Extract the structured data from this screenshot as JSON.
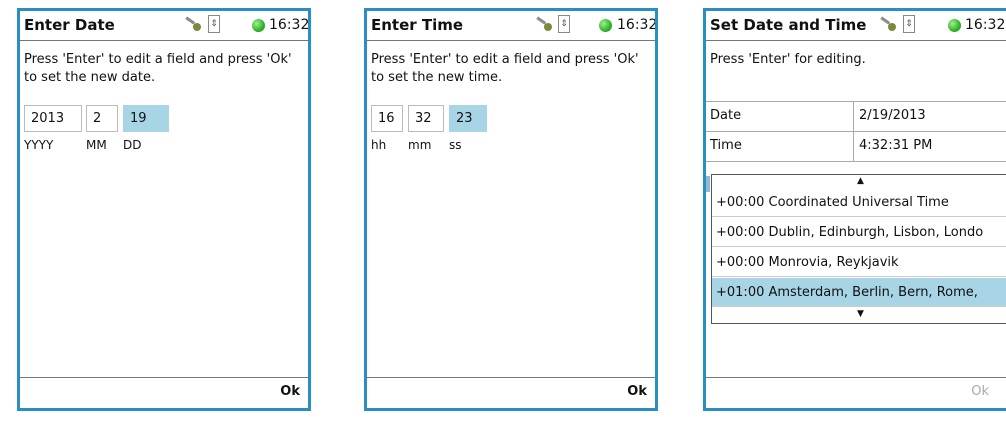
{
  "screens": [
    {
      "title": "Enter Date",
      "clock": "16:32",
      "instruction": "Press 'Enter' to edit a field and press 'Ok' to set the new date.",
      "fields": [
        {
          "value": "2013",
          "label": "YYYY"
        },
        {
          "value": "2",
          "label": "MM"
        },
        {
          "value": "19",
          "label": "DD",
          "active": true
        }
      ],
      "ok_label": "Ok"
    },
    {
      "title": "Enter Time",
      "clock": "16:32",
      "instruction": "Press 'Enter' to edit a field and press 'Ok' to set the new time.",
      "fields": [
        {
          "value": "16",
          "label": "hh"
        },
        {
          "value": "32",
          "label": "mm"
        },
        {
          "value": "23",
          "label": "ss",
          "active": true
        }
      ],
      "ok_label": "Ok"
    },
    {
      "title": "Set Date and Time",
      "clock": "16:32",
      "instruction": "Press 'Enter' for editing.",
      "rows": [
        {
          "key": "Date",
          "value": "2/19/2013"
        },
        {
          "key": "Time",
          "value": "4:32:31 PM"
        }
      ],
      "timezones": [
        "+00:00 Coordinated Universal Time",
        "+00:00 Dublin, Edinburgh, Lisbon, Londo",
        "+00:00 Monrovia, Reykjavik",
        "+01:00 Amsterdam, Berlin, Bern, Rome,"
      ],
      "selected_timezone_index": 3,
      "ok_label": "Ok"
    }
  ],
  "colors": {
    "frame": "#2a8fc0",
    "highlight": "#a8d5e6",
    "status": "#2fb32a"
  },
  "icons": {
    "status_key": "key-icon",
    "status_usb": "usb-icon",
    "status_led": "status-dot-icon",
    "scroll_up": "triangle-up-icon",
    "scroll_down": "triangle-down-icon"
  }
}
